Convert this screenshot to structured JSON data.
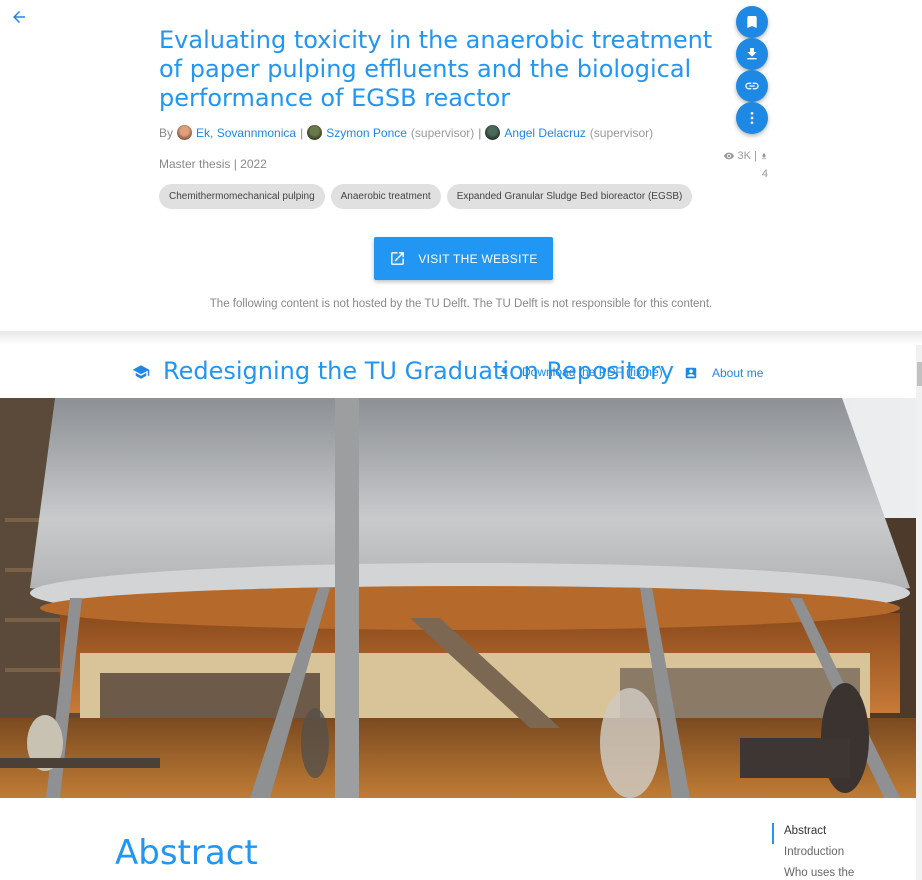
{
  "paper": {
    "title": "Evaluating toxicity in the anaerobic treatment of paper pulping effluents and the biological performance of EGSB reactor",
    "by_label": "By",
    "authors": [
      {
        "name": "Ek, Sovannmonica",
        "role": ""
      },
      {
        "name": "Szymon Ponce",
        "role": "(supervisor)"
      },
      {
        "name": "Angel Delacruz",
        "role": "(supervisor)"
      }
    ],
    "author_separator": "|",
    "meta": "Master thesis | 2022",
    "views": "3K",
    "stats_separator": "|",
    "downloads": "4",
    "keywords": [
      "Chemithermomechanical pulping",
      "Anaerobic treatment",
      "Expanded Granular Sludge Bed bioreactor (EGSB)"
    ],
    "visit_button": "VISIT THE WEBSITE",
    "disclaimer": "The following content is not hosted by the TU Delft. The TU Delft is not responsible for this content."
  },
  "actions": {
    "icons": [
      "bookmark-icon",
      "download-icon",
      "link-icon",
      "more-vert-icon"
    ]
  },
  "embedded": {
    "header_title": "Redesigning the TU Graduation Repository",
    "download_pdf": "Download the PDF (fixme)",
    "about_me": "About me",
    "section_title": "Abstract",
    "toc": [
      "Abstract",
      "Introduction",
      "Who uses the"
    ]
  },
  "colors": {
    "accent": "#2196f3",
    "fab": "#1e88e5",
    "chip_bg": "#e0e0e0"
  }
}
